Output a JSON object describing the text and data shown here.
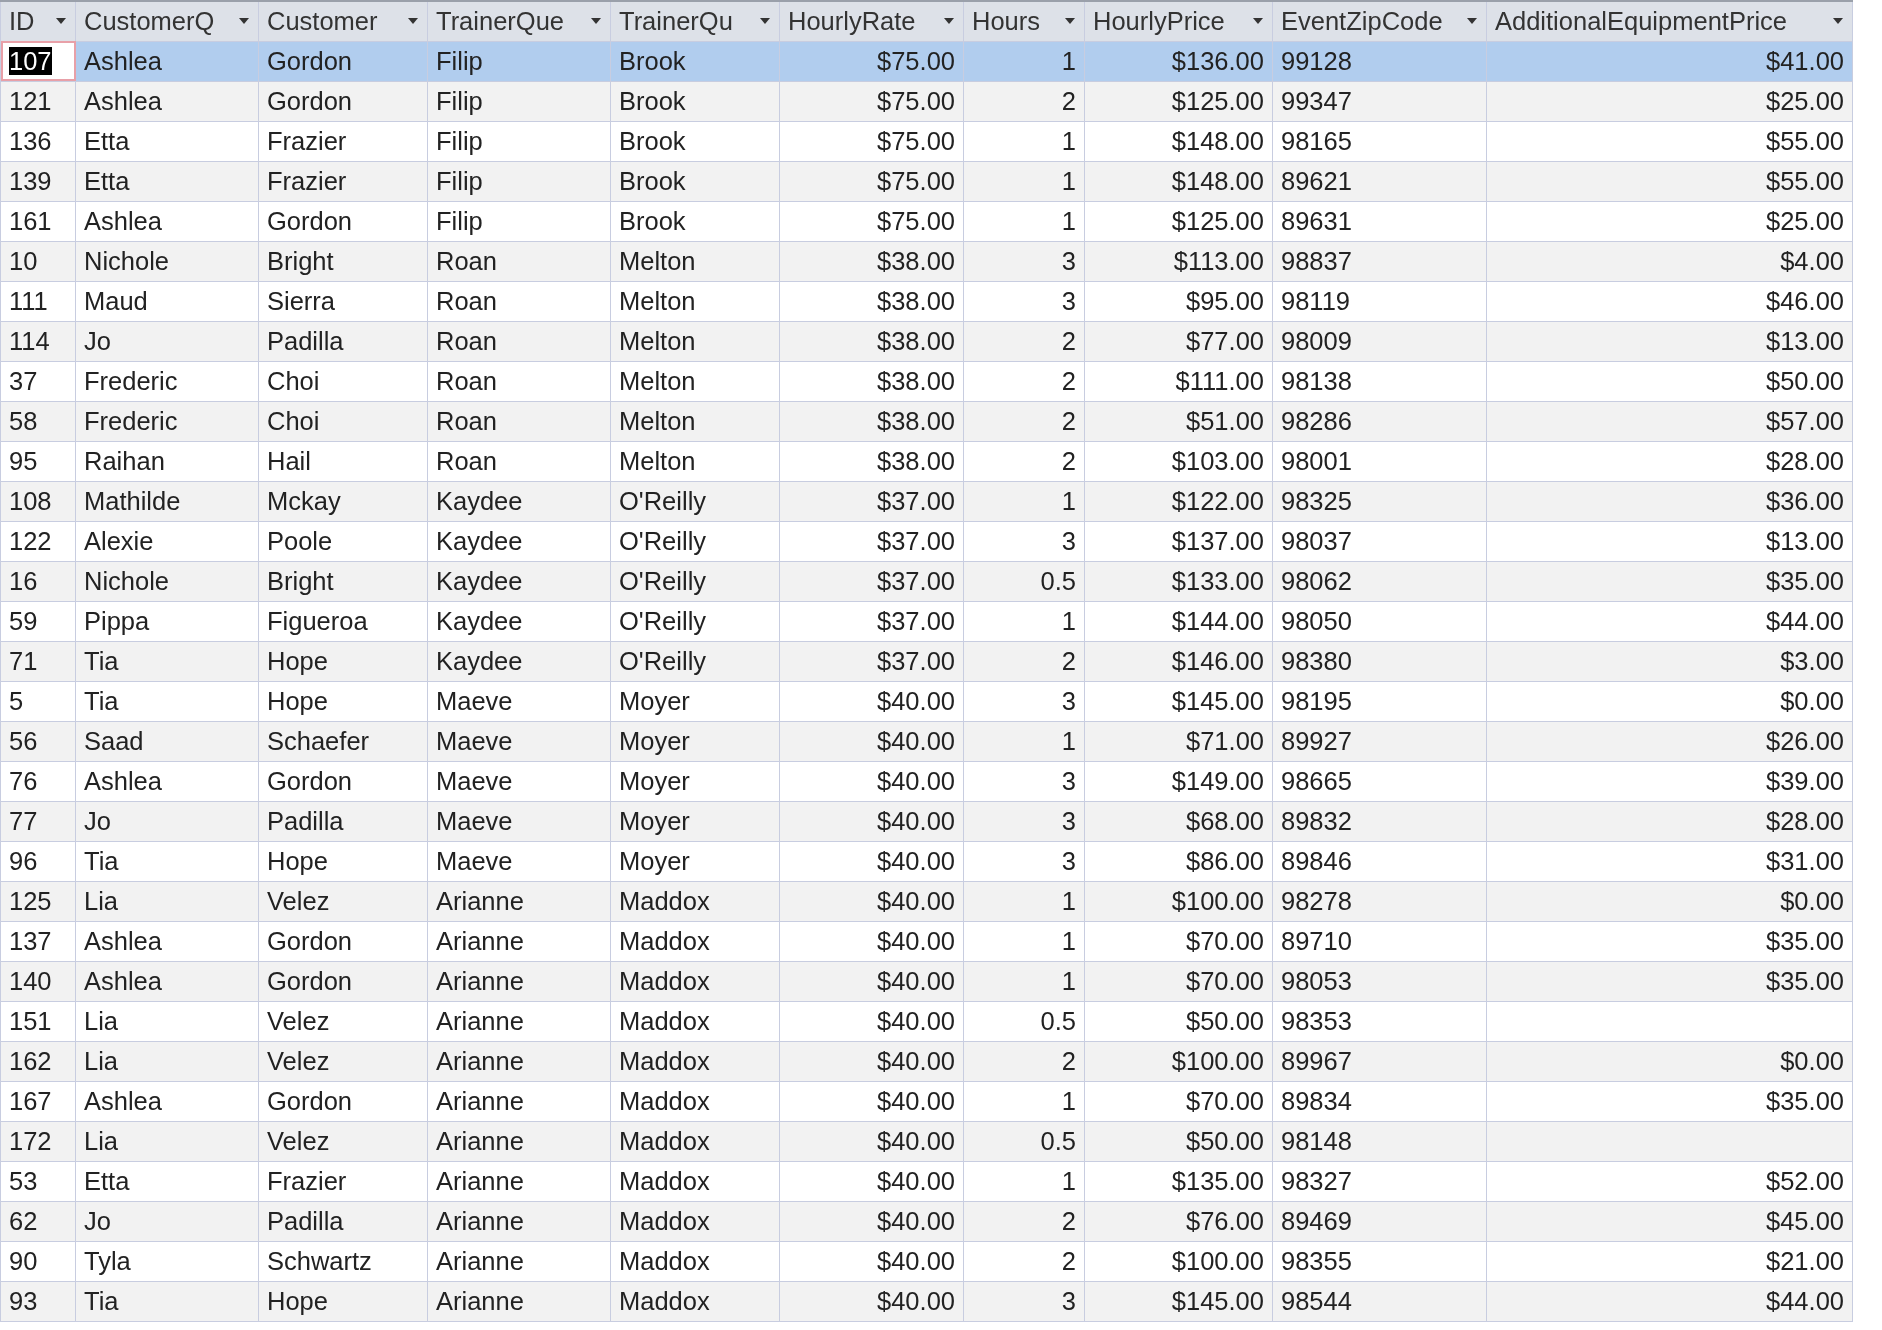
{
  "columns": [
    {
      "label": "ID",
      "kind": "text"
    },
    {
      "label": "CustomerQ",
      "kind": "text"
    },
    {
      "label": "Customer",
      "kind": "text"
    },
    {
      "label": "TrainerQue",
      "kind": "text"
    },
    {
      "label": "TrainerQu",
      "kind": "text"
    },
    {
      "label": "HourlyRate",
      "kind": "number"
    },
    {
      "label": "Hours",
      "kind": "number"
    },
    {
      "label": "HourlyPrice",
      "kind": "number"
    },
    {
      "label": "EventZipCode",
      "kind": "text"
    },
    {
      "label": "AdditionalEquipmentPrice",
      "kind": "number"
    }
  ],
  "rows": [
    {
      "selected": true,
      "focused": true,
      "cells": [
        "107",
        "Ashlea",
        "Gordon",
        "Filip",
        "Brook",
        "$75.00",
        "1",
        "$136.00",
        "99128",
        "$41.00"
      ]
    },
    {
      "selected": false,
      "focused": false,
      "cells": [
        "121",
        "Ashlea",
        "Gordon",
        "Filip",
        "Brook",
        "$75.00",
        "2",
        "$125.00",
        "99347",
        "$25.00"
      ]
    },
    {
      "selected": false,
      "focused": false,
      "cells": [
        "136",
        "Etta",
        "Frazier",
        "Filip",
        "Brook",
        "$75.00",
        "1",
        "$148.00",
        "98165",
        "$55.00"
      ]
    },
    {
      "selected": false,
      "focused": false,
      "cells": [
        "139",
        "Etta",
        "Frazier",
        "Filip",
        "Brook",
        "$75.00",
        "1",
        "$148.00",
        "89621",
        "$55.00"
      ]
    },
    {
      "selected": false,
      "focused": false,
      "cells": [
        "161",
        "Ashlea",
        "Gordon",
        "Filip",
        "Brook",
        "$75.00",
        "1",
        "$125.00",
        "89631",
        "$25.00"
      ]
    },
    {
      "selected": false,
      "focused": false,
      "cells": [
        "10",
        "Nichole",
        "Bright",
        "Roan",
        "Melton",
        "$38.00",
        "3",
        "$113.00",
        "98837",
        "$4.00"
      ]
    },
    {
      "selected": false,
      "focused": false,
      "cells": [
        "111",
        "Maud",
        "Sierra",
        "Roan",
        "Melton",
        "$38.00",
        "3",
        "$95.00",
        "98119",
        "$46.00"
      ]
    },
    {
      "selected": false,
      "focused": false,
      "cells": [
        "114",
        "Jo",
        "Padilla",
        "Roan",
        "Melton",
        "$38.00",
        "2",
        "$77.00",
        "98009",
        "$13.00"
      ]
    },
    {
      "selected": false,
      "focused": false,
      "cells": [
        "37",
        "Frederic",
        "Choi",
        "Roan",
        "Melton",
        "$38.00",
        "2",
        "$111.00",
        "98138",
        "$50.00"
      ]
    },
    {
      "selected": false,
      "focused": false,
      "cells": [
        "58",
        "Frederic",
        "Choi",
        "Roan",
        "Melton",
        "$38.00",
        "2",
        "$51.00",
        "98286",
        "$57.00"
      ]
    },
    {
      "selected": false,
      "focused": false,
      "cells": [
        "95",
        "Raihan",
        "Hail",
        "Roan",
        "Melton",
        "$38.00",
        "2",
        "$103.00",
        "98001",
        "$28.00"
      ]
    },
    {
      "selected": false,
      "focused": false,
      "cells": [
        "108",
        "Mathilde",
        "Mckay",
        "Kaydee",
        "O'Reilly",
        "$37.00",
        "1",
        "$122.00",
        "98325",
        "$36.00"
      ]
    },
    {
      "selected": false,
      "focused": false,
      "cells": [
        "122",
        "Alexie",
        "Poole",
        "Kaydee",
        "O'Reilly",
        "$37.00",
        "3",
        "$137.00",
        "98037",
        "$13.00"
      ]
    },
    {
      "selected": false,
      "focused": false,
      "cells": [
        "16",
        "Nichole",
        "Bright",
        "Kaydee",
        "O'Reilly",
        "$37.00",
        "0.5",
        "$133.00",
        "98062",
        "$35.00"
      ]
    },
    {
      "selected": false,
      "focused": false,
      "cells": [
        "59",
        "Pippa",
        "Figueroa",
        "Kaydee",
        "O'Reilly",
        "$37.00",
        "1",
        "$144.00",
        "98050",
        "$44.00"
      ]
    },
    {
      "selected": false,
      "focused": false,
      "cells": [
        "71",
        "Tia",
        "Hope",
        "Kaydee",
        "O'Reilly",
        "$37.00",
        "2",
        "$146.00",
        "98380",
        "$3.00"
      ]
    },
    {
      "selected": false,
      "focused": false,
      "cells": [
        "5",
        "Tia",
        "Hope",
        "Maeve",
        "Moyer",
        "$40.00",
        "3",
        "$145.00",
        "98195",
        "$0.00"
      ]
    },
    {
      "selected": false,
      "focused": false,
      "cells": [
        "56",
        "Saad",
        "Schaefer",
        "Maeve",
        "Moyer",
        "$40.00",
        "1",
        "$71.00",
        "89927",
        "$26.00"
      ]
    },
    {
      "selected": false,
      "focused": false,
      "cells": [
        "76",
        "Ashlea",
        "Gordon",
        "Maeve",
        "Moyer",
        "$40.00",
        "3",
        "$149.00",
        "98665",
        "$39.00"
      ]
    },
    {
      "selected": false,
      "focused": false,
      "cells": [
        "77",
        "Jo",
        "Padilla",
        "Maeve",
        "Moyer",
        "$40.00",
        "3",
        "$68.00",
        "89832",
        "$28.00"
      ]
    },
    {
      "selected": false,
      "focused": false,
      "cells": [
        "96",
        "Tia",
        "Hope",
        "Maeve",
        "Moyer",
        "$40.00",
        "3",
        "$86.00",
        "89846",
        "$31.00"
      ]
    },
    {
      "selected": false,
      "focused": false,
      "cells": [
        "125",
        "Lia",
        "Velez",
        "Arianne",
        "Maddox",
        "$40.00",
        "1",
        "$100.00",
        "98278",
        "$0.00"
      ]
    },
    {
      "selected": false,
      "focused": false,
      "cells": [
        "137",
        "Ashlea",
        "Gordon",
        "Arianne",
        "Maddox",
        "$40.00",
        "1",
        "$70.00",
        "89710",
        "$35.00"
      ]
    },
    {
      "selected": false,
      "focused": false,
      "cells": [
        "140",
        "Ashlea",
        "Gordon",
        "Arianne",
        "Maddox",
        "$40.00",
        "1",
        "$70.00",
        "98053",
        "$35.00"
      ]
    },
    {
      "selected": false,
      "focused": false,
      "cells": [
        "151",
        "Lia",
        "Velez",
        "Arianne",
        "Maddox",
        "$40.00",
        "0.5",
        "$50.00",
        "98353"
      ]
    },
    {
      "selected": false,
      "focused": false,
      "cells": [
        "162",
        "Lia",
        "Velez",
        "Arianne",
        "Maddox",
        "$40.00",
        "2",
        "$100.00",
        "89967",
        "$0.00"
      ]
    },
    {
      "selected": false,
      "focused": false,
      "cells": [
        "167",
        "Ashlea",
        "Gordon",
        "Arianne",
        "Maddox",
        "$40.00",
        "1",
        "$70.00",
        "89834",
        "$35.00"
      ]
    },
    {
      "selected": false,
      "focused": false,
      "cells": [
        "172",
        "Lia",
        "Velez",
        "Arianne",
        "Maddox",
        "$40.00",
        "0.5",
        "$50.00",
        "98148"
      ]
    },
    {
      "selected": false,
      "focused": false,
      "cells": [
        "53",
        "Etta",
        "Frazier",
        "Arianne",
        "Maddox",
        "$40.00",
        "1",
        "$135.00",
        "98327",
        "$52.00"
      ]
    },
    {
      "selected": false,
      "focused": false,
      "cells": [
        "62",
        "Jo",
        "Padilla",
        "Arianne",
        "Maddox",
        "$40.00",
        "2",
        "$76.00",
        "89469",
        "$45.00"
      ]
    },
    {
      "selected": false,
      "focused": false,
      "cells": [
        "90",
        "Tyla",
        "Schwartz",
        "Arianne",
        "Maddox",
        "$40.00",
        "2",
        "$100.00",
        "98355",
        "$21.00"
      ]
    },
    {
      "selected": false,
      "focused": false,
      "cells": [
        "93",
        "Tia",
        "Hope",
        "Arianne",
        "Maddox",
        "$40.00",
        "3",
        "$145.00",
        "98544",
        "$44.00"
      ]
    }
  ]
}
